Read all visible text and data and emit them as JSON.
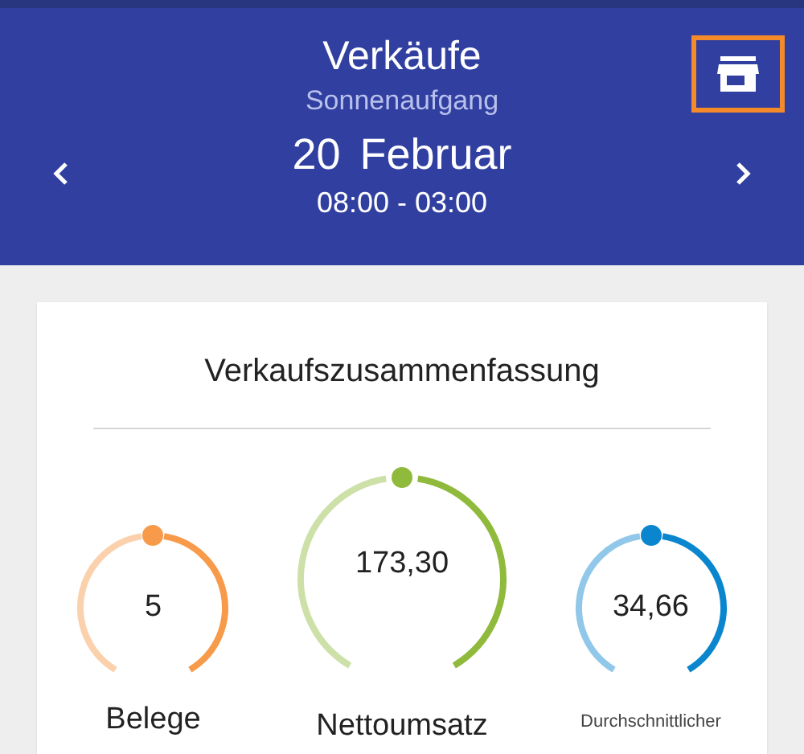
{
  "header": {
    "title": "Verkäufe",
    "subtitle": "Sonnenaufgang",
    "date_day": "20",
    "date_month": "Februar",
    "time_range": "08:00 - 03:00",
    "store_button": {
      "highlighted": true
    }
  },
  "summary": {
    "title": "Verkaufszusammenfassung",
    "gauges": [
      {
        "kind": "small",
        "value": "5",
        "label": "Belege",
        "color": "#f79a4a"
      },
      {
        "kind": "large",
        "value": "173,30",
        "label": "Nettoumsatz",
        "color": "#8fba3c"
      },
      {
        "kind": "small",
        "value": "34,66",
        "label": "Durchschnittlicher",
        "color": "#0a86cf"
      }
    ]
  }
}
